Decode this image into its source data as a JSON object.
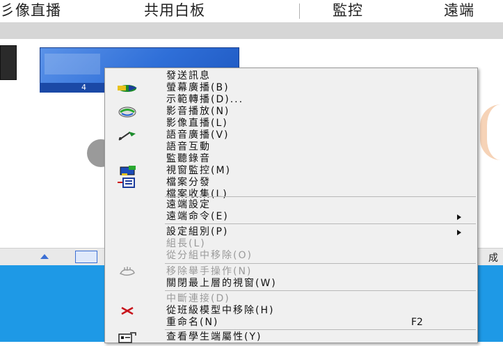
{
  "toolbar": {
    "items": [
      "彡像直播",
      "共用白板",
      "監控",
      "遠端"
    ]
  },
  "thumbnail": {
    "caption": "4"
  },
  "statusbar": {
    "right_text": "成"
  },
  "context_menu": {
    "items": [
      {
        "label": "發送訊息",
        "icon": null
      },
      {
        "label": "螢幕廣播(B)",
        "icon": "screen-broadcast-icon"
      },
      {
        "label": "示範轉播(D)...",
        "icon": null
      },
      {
        "label": "影音播放(N)",
        "icon": "media-play-icon"
      },
      {
        "label": "影像直播(L)",
        "icon": null
      },
      {
        "label": "語音廣播(V)",
        "icon": "voice-broadcast-icon"
      },
      {
        "label": "語音互動",
        "icon": null
      },
      {
        "label": "監聽錄音",
        "icon": null
      },
      {
        "label": "視窗監控(M)",
        "icon": "window-monitor-icon"
      },
      {
        "label": "檔案分發",
        "icon": "file-distribute-icon"
      },
      {
        "label": "檔案收集(L)",
        "icon": null
      },
      {
        "label": "遠端設定",
        "icon": null
      },
      {
        "label": "遠端命令(E)",
        "icon": null,
        "submenu": true
      },
      {
        "label": "設定組別(P)",
        "icon": null,
        "submenu": true
      },
      {
        "label": "組長(L)",
        "icon": null,
        "disabled": true
      },
      {
        "label": "從分組中移除(O)",
        "icon": null,
        "disabled": true
      },
      {
        "label": "移除舉手操作(N)",
        "icon": "raise-hand-icon",
        "disabled": true
      },
      {
        "label": "關閉最上層的視窗(W)",
        "icon": null
      },
      {
        "label": "中斷連接(D)",
        "icon": null,
        "disabled": true
      },
      {
        "label": "從班級模型中移除(H)",
        "icon": "remove-x-icon"
      },
      {
        "label": "重命名(N)",
        "icon": null,
        "shortcut": "F2"
      },
      {
        "label": "查看學生端屬性(Y)",
        "icon": "properties-icon"
      }
    ]
  }
}
